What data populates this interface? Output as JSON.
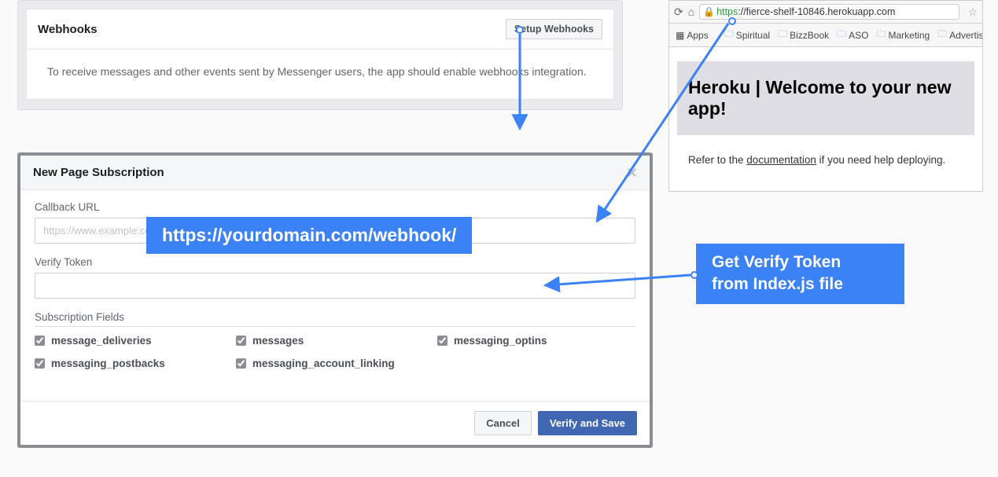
{
  "webhooks_panel": {
    "title": "Webhooks",
    "setup_button": "Setup Webhooks",
    "description": "To receive messages and other events sent by Messenger users, the app should enable webhooks integration."
  },
  "dialog": {
    "title": "New Page Subscription",
    "callback_label": "Callback URL",
    "callback_placeholder": "https://www.example.com/callback",
    "callback_visible_value": "https://www.example.c",
    "verify_label": "Verify Token",
    "verify_value": "",
    "sub_fields_label": "Subscription Fields",
    "fields": [
      {
        "name": "message_deliveries",
        "checked": true
      },
      {
        "name": "messages",
        "checked": true
      },
      {
        "name": "messaging_optins",
        "checked": true
      },
      {
        "name": "messaging_postbacks",
        "checked": true
      },
      {
        "name": "messaging_account_linking",
        "checked": true
      }
    ],
    "cancel": "Cancel",
    "verify_save": "Verify and Save"
  },
  "browser": {
    "url_https": "https",
    "url_rest": "://fierce-shelf-10846.herokuapp.com",
    "bookmarks_label": "Apps",
    "bookmarks": [
      "Spiritual",
      "BizzBook",
      "ASO",
      "Marketing",
      "Advertising"
    ],
    "heroku_title": "Heroku | Welcome to your new app!",
    "heroku_text_pre": "Refer to the ",
    "heroku_link": "documentation",
    "heroku_text_post": " if you need help deploying."
  },
  "annotations": {
    "callback_hint": "https://yourdomain.com/webhook/",
    "verify_hint_l1": "Get Verify Token",
    "verify_hint_l2": "from Index.js file"
  }
}
